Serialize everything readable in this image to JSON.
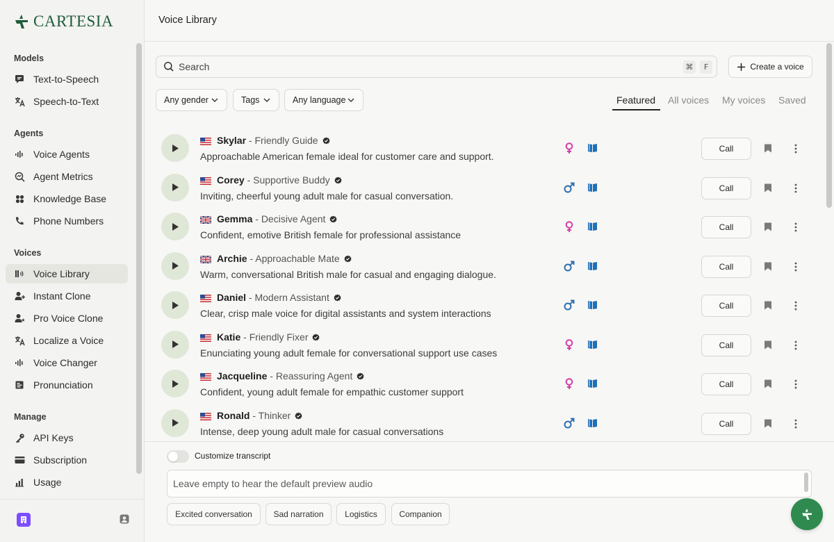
{
  "brand": {
    "name": "CARTESIA",
    "color": "#1f5c3a"
  },
  "sidebar": {
    "sections": [
      {
        "title": "Models",
        "items": [
          {
            "label": "Text-to-Speech",
            "icon": "speech-bubble-icon"
          },
          {
            "label": "Speech-to-Text",
            "icon": "translate-icon"
          }
        ]
      },
      {
        "title": "Agents",
        "items": [
          {
            "label": "Voice Agents",
            "icon": "waveform-icon"
          },
          {
            "label": "Agent Metrics",
            "icon": "magnifier-chart-icon"
          },
          {
            "label": "Knowledge Base",
            "icon": "knowledge-icon"
          },
          {
            "label": "Phone Numbers",
            "icon": "phone-icon"
          }
        ]
      },
      {
        "title": "Voices",
        "items": [
          {
            "label": "Voice Library",
            "icon": "voice-library-icon",
            "active": true
          },
          {
            "label": "Instant Clone",
            "icon": "user-plus-icon"
          },
          {
            "label": "Pro Voice Clone",
            "icon": "user-star-icon"
          },
          {
            "label": "Localize a Voice",
            "icon": "translate-icon"
          },
          {
            "label": "Voice Changer",
            "icon": "waveform-icon"
          },
          {
            "label": "Pronunciation",
            "icon": "dictionary-icon"
          }
        ]
      },
      {
        "title": "Manage",
        "items": [
          {
            "label": "API Keys",
            "icon": "key-icon"
          },
          {
            "label": "Subscription",
            "icon": "card-icon"
          },
          {
            "label": "Usage",
            "icon": "bar-chart-icon"
          }
        ]
      }
    ]
  },
  "header": {
    "title": "Voice Library"
  },
  "search": {
    "placeholder": "Search",
    "shortcut_keys": [
      "⌘",
      "F"
    ]
  },
  "create_button": {
    "label": "Create a voice"
  },
  "filters": [
    {
      "label": "Any gender"
    },
    {
      "label": "Tags"
    },
    {
      "label": "Any language"
    }
  ],
  "tabs": [
    {
      "label": "Featured",
      "active": true
    },
    {
      "label": "All voices"
    },
    {
      "label": "My voices"
    },
    {
      "label": "Saved"
    }
  ],
  "voices": [
    {
      "name": "Skylar",
      "title": "Friendly Guide",
      "flag": "us",
      "gender": "female",
      "description": "Approachable American female ideal for customer care and support.",
      "call_label": "Call"
    },
    {
      "name": "Corey",
      "title": "Supportive Buddy",
      "flag": "us",
      "gender": "male",
      "description": "Inviting, cheerful young adult male for casual conversation.",
      "call_label": "Call"
    },
    {
      "name": "Gemma",
      "title": "Decisive Agent",
      "flag": "uk",
      "gender": "female",
      "description": "Confident, emotive British female for professional assistance",
      "call_label": "Call"
    },
    {
      "name": "Archie",
      "title": "Approachable Mate",
      "flag": "uk",
      "gender": "male",
      "description": "Warm, conversational British male for casual and engaging dialogue.",
      "call_label": "Call"
    },
    {
      "name": "Daniel",
      "title": "Modern Assistant",
      "flag": "us",
      "gender": "male",
      "description": "Clear, crisp male voice for digital assistants and system interactions",
      "call_label": "Call"
    },
    {
      "name": "Katie",
      "title": "Friendly Fixer",
      "flag": "us",
      "gender": "female",
      "description": "Enunciating young adult female for conversational support use cases",
      "call_label": "Call"
    },
    {
      "name": "Jacqueline",
      "title": "Reassuring Agent",
      "flag": "us",
      "gender": "female",
      "description": "Confident, young adult female for empathic customer support",
      "call_label": "Call"
    },
    {
      "name": "Ronald",
      "title": "Thinker",
      "flag": "us",
      "gender": "male",
      "description": "Intense, deep young adult male for casual conversations",
      "call_label": "Call"
    }
  ],
  "bottom": {
    "toggle_label": "Customize transcript",
    "transcript_placeholder": "Leave empty to hear the default preview audio",
    "presets": [
      "Excited conversation",
      "Sad narration",
      "Logistics",
      "Companion"
    ]
  },
  "colors": {
    "female": "#d63ca8",
    "male": "#2f6fb0",
    "book": "#1f6fb8",
    "accent": "#2f8a4f"
  }
}
